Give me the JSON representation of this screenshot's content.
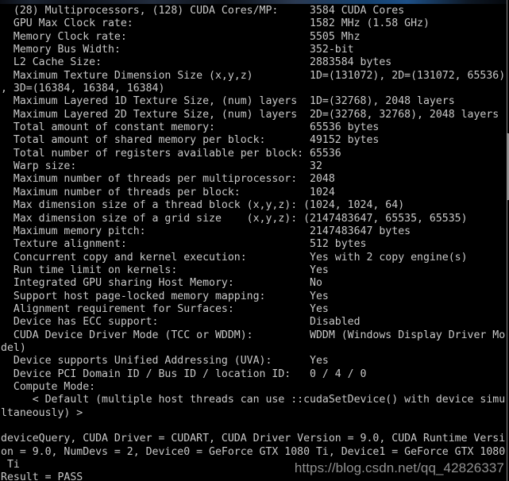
{
  "window": {
    "type": "console-terminal",
    "background_color": "#000000",
    "text_color": "#c8c8c8",
    "chrome_accent_color": "#1d4f86"
  },
  "scrollbar": {
    "present": true,
    "orientation": "vertical",
    "track_color": "#000000",
    "thumb_color": "#7e7e7e"
  },
  "watermark": {
    "text": "https://blog.csdn.net/qq_42826337",
    "color": "#9d9d9d"
  },
  "console": {
    "lines": [
      "  (28) Multiprocessors, (128) CUDA Cores/MP:     3584 CUDA Cores",
      "  GPU Max Clock rate:                            1582 MHz (1.58 GHz)",
      "  Memory Clock rate:                             5505 Mhz",
      "  Memory Bus Width:                              352-bit",
      "  L2 Cache Size:                                 2883584 bytes",
      "  Maximum Texture Dimension Size (x,y,z)         1D=(131072), 2D=(131072, 65536)",
      ", 3D=(16384, 16384, 16384)",
      "  Maximum Layered 1D Texture Size, (num) layers  1D=(32768), 2048 layers",
      "  Maximum Layered 2D Texture Size, (num) layers  2D=(32768, 32768), 2048 layers",
      "  Total amount of constant memory:               65536 bytes",
      "  Total amount of shared memory per block:       49152 bytes",
      "  Total number of registers available per block: 65536",
      "  Warp size:                                     32",
      "  Maximum number of threads per multiprocessor:  2048",
      "  Maximum number of threads per block:           1024",
      "  Max dimension size of a thread block (x,y,z): (1024, 1024, 64)",
      "  Max dimension size of a grid size    (x,y,z): (2147483647, 65535, 65535)",
      "  Maximum memory pitch:                          2147483647 bytes",
      "  Texture alignment:                             512 bytes",
      "  Concurrent copy and kernel execution:          Yes with 2 copy engine(s)",
      "  Run time limit on kernels:                     Yes",
      "  Integrated GPU sharing Host Memory:            No",
      "  Support host page-locked memory mapping:       Yes",
      "  Alignment requirement for Surfaces:            Yes",
      "  Device has ECC support:                        Disabled",
      "  CUDA Device Driver Mode (TCC or WDDM):         WDDM (Windows Display Driver Mo",
      "del)",
      "  Device supports Unified Addressing (UVA):      Yes",
      "  Device PCI Domain ID / Bus ID / location ID:   0 / 4 / 0",
      "  Compute Mode:",
      "     < Default (multiple host threads can use ::cudaSetDevice() with device simu",
      "ltaneously) >",
      "",
      "deviceQuery, CUDA Driver = CUDART, CUDA Driver Version = 9.0, CUDA Runtime Versi",
      "on = 9.0, NumDevs = 2, Device0 = GeForce GTX 1080 Ti, Device1 = GeForce GTX 1080",
      " Ti",
      "Result = PASS"
    ]
  }
}
